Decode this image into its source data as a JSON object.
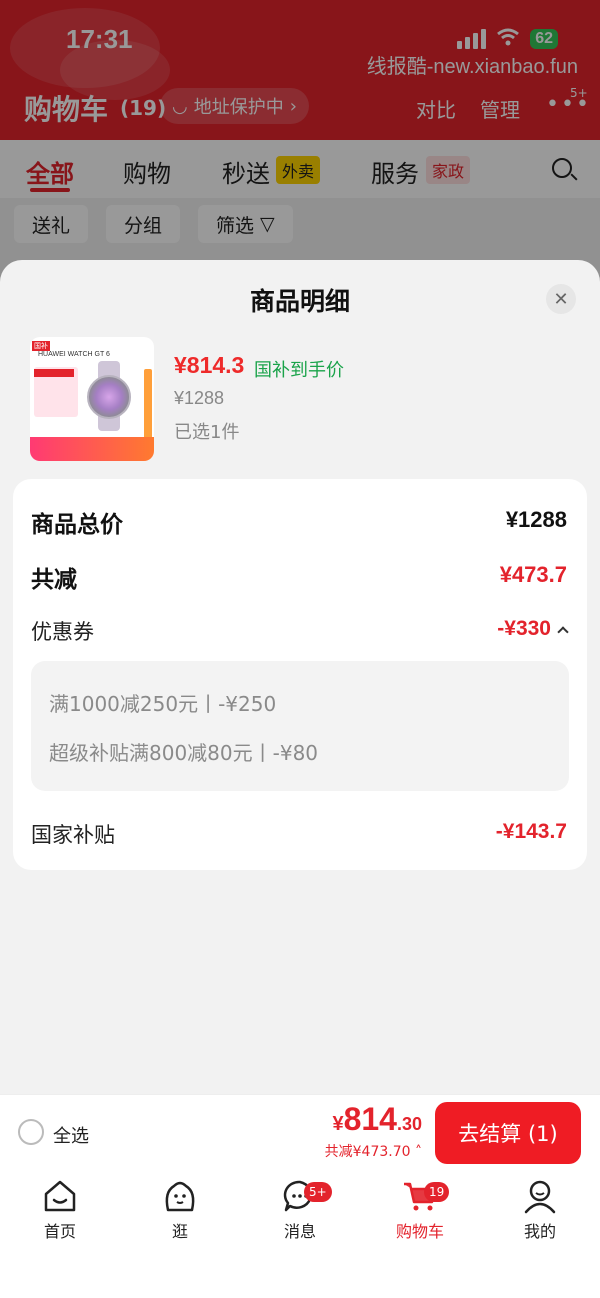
{
  "status_bar": {
    "time": "17:31",
    "battery": "62",
    "watermark": "线报酷-new.xianbao.fun"
  },
  "header": {
    "title": "购物车",
    "count": "(19)",
    "address_protect": "地址保护中",
    "compare": "对比",
    "manage": "管理",
    "more_badge": "5+"
  },
  "tabs": [
    {
      "label": "全部"
    },
    {
      "label": "购物"
    },
    {
      "label": "秒送",
      "tag": "外卖"
    },
    {
      "label": "服务",
      "tag": "家政"
    }
  ],
  "filters": {
    "gift": "送礼",
    "group": "分组",
    "filter": "筛选"
  },
  "sheet": {
    "title": "商品明细",
    "product": {
      "image_brand": "HUAWEI WATCH GT 6",
      "price": "¥814.3",
      "price_tag": "国补到手价",
      "original_price": "¥1288",
      "selected": "已选1件"
    },
    "summary": {
      "total_label": "商品总价",
      "total_value": "¥1288",
      "discount_label": "共减",
      "discount_value": "¥473.7",
      "coupon_label": "优惠券",
      "coupon_value": "-¥330",
      "coupons": [
        "满1000减250元丨-¥250",
        "超级补贴满800减80元丨-¥80"
      ],
      "subsidy_label": "国家补贴",
      "subsidy_value": "-¥143.7"
    }
  },
  "bottom_bar": {
    "select_all": "全选",
    "currency": "¥",
    "total_int": "814",
    "total_dec": ".30",
    "saved": "共减¥473.70",
    "checkout": "去结算 (1)"
  },
  "tabbar": [
    {
      "label": "首页",
      "icon": "home-icon"
    },
    {
      "label": "逛",
      "icon": "browse-icon"
    },
    {
      "label": "消息",
      "icon": "message-icon",
      "badge": "5+"
    },
    {
      "label": "购物车",
      "icon": "cart-icon",
      "badge": "19"
    },
    {
      "label": "我的",
      "icon": "profile-icon"
    }
  ],
  "colors": {
    "brand_red": "#e3232c",
    "subsidy_green": "#1aa34a",
    "checkout_red": "#ef1c24"
  }
}
